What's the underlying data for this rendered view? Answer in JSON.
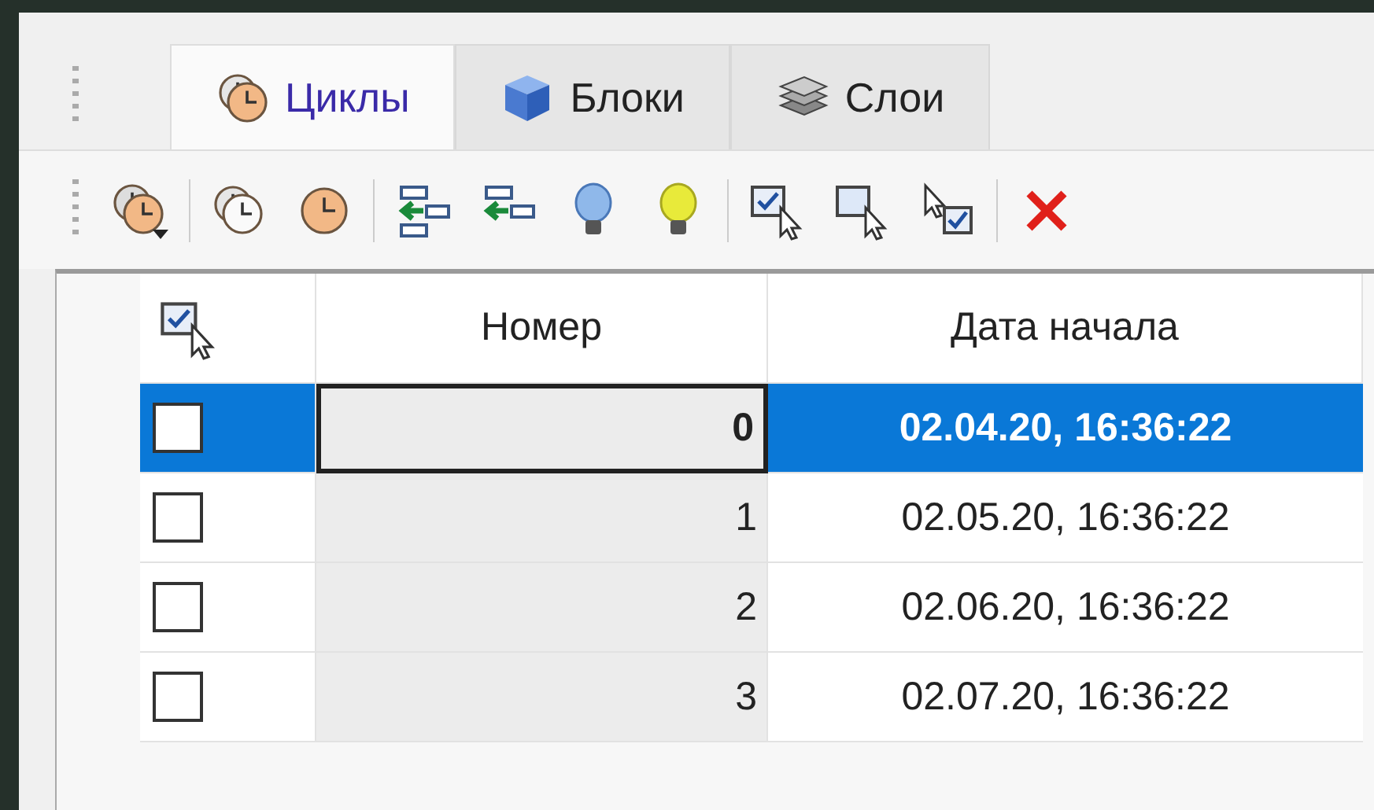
{
  "tabs": [
    {
      "label": "Циклы",
      "selected": true
    },
    {
      "label": "Блоки",
      "selected": false
    },
    {
      "label": "Слои",
      "selected": false
    }
  ],
  "table": {
    "columns": [
      "Номер",
      "Дата начала"
    ],
    "rows": [
      {
        "checked": false,
        "selected": true,
        "focused": true,
        "number": "0",
        "start_date": "02.04.20, 16:36:22"
      },
      {
        "checked": false,
        "selected": false,
        "focused": false,
        "number": "1",
        "start_date": "02.05.20, 16:36:22"
      },
      {
        "checked": false,
        "selected": false,
        "focused": false,
        "number": "2",
        "start_date": "02.06.20, 16:36:22"
      },
      {
        "checked": false,
        "selected": false,
        "focused": false,
        "number": "3",
        "start_date": "02.07.20, 16:36:22"
      }
    ]
  }
}
